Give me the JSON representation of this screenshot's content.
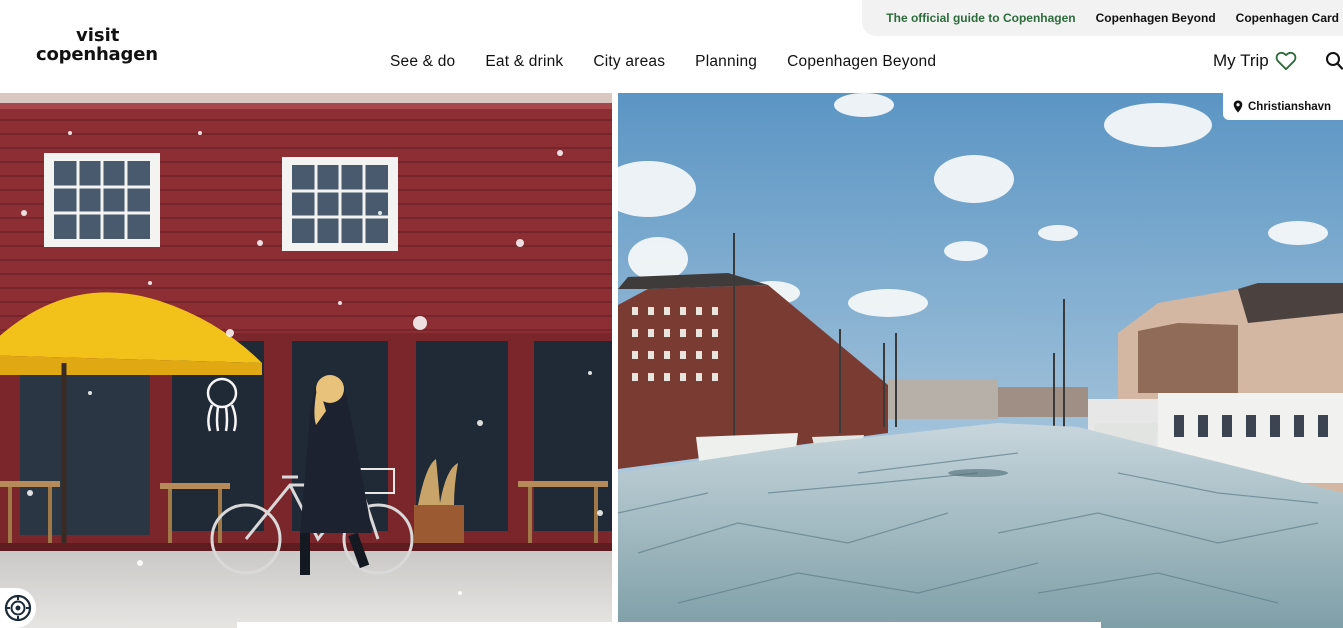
{
  "logo": {
    "line1": "visit",
    "line2": "copenhagen"
  },
  "utility_nav": {
    "guide_label": "The official guide to Copenhagen",
    "beyond_label": "Copenhagen Beyond",
    "card_label": "Copenhagen Card"
  },
  "main_nav": {
    "items": [
      {
        "label": "See & do"
      },
      {
        "label": "Eat & drink"
      },
      {
        "label": "City areas"
      },
      {
        "label": "Planning"
      },
      {
        "label": "Copenhagen Beyond"
      }
    ]
  },
  "my_trip": {
    "label": "My Trip",
    "icon": "heart-icon"
  },
  "search": {
    "icon": "search-icon"
  },
  "hero": {
    "location_label": "Christianshavn",
    "location_icon": "map-pin-icon"
  },
  "accessibility": {
    "icon": "accessibility-icon"
  },
  "colors": {
    "accent_green": "#2e6b3c",
    "utility_bar_bg": "#f1f2f1",
    "wall_red": "#8c2e33",
    "umbrella_yellow": "#f2c21b",
    "sky_blue": "#7fb3d8",
    "canal_ice": "#a9c2c9"
  }
}
